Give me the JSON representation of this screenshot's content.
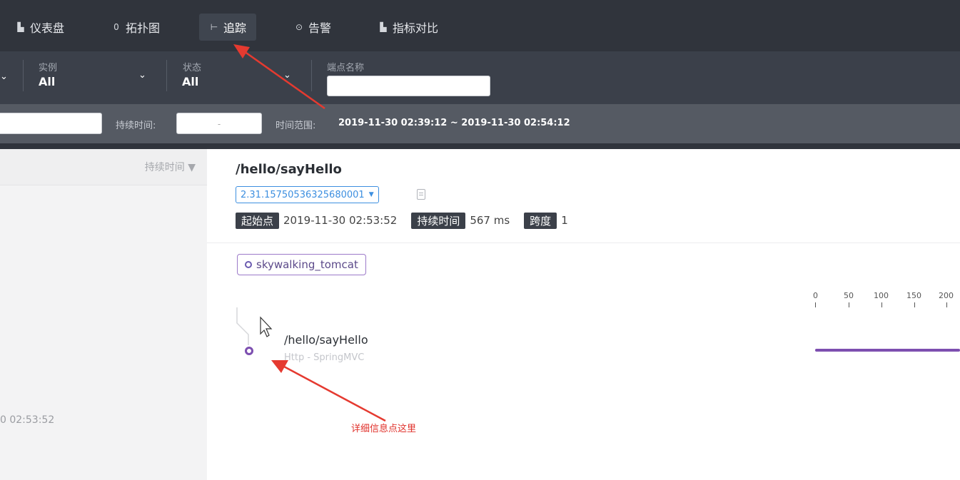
{
  "nav": {
    "items": [
      {
        "label": "仪表盘",
        "icon": "bar-chart-icon"
      },
      {
        "label": "拓扑图",
        "icon": "topology-icon"
      },
      {
        "label": "追踪",
        "icon": "trace-icon"
      },
      {
        "label": "告警",
        "icon": "alarm-icon"
      },
      {
        "label": "指标对比",
        "icon": "bar-chart-icon"
      }
    ],
    "active_label": "追踪"
  },
  "filters": {
    "instance": {
      "label": "实例",
      "value": "All"
    },
    "status": {
      "label": "状态",
      "value": "All"
    },
    "endpoint": {
      "label": "端点名称",
      "value": ""
    }
  },
  "timebar": {
    "duration_label": "持续时间:",
    "duration_dash": "-",
    "range_label": "时间范围:",
    "range_value": "2019-11-30 02:39:12 ~ 2019-11-30 02:54:12"
  },
  "list": {
    "sort_label": "持续时间 ▼",
    "item_time": "0 02:53:52"
  },
  "trace": {
    "title": "/hello/sayHello",
    "trace_id": "2.31.15750536325680001",
    "start_tag": "起始点",
    "start_value": "2019-11-30 02:53:52",
    "duration_tag": "持续时间",
    "duration_value": "567 ms",
    "span_tag": "跨度",
    "span_value": "1",
    "service": "skywalking_tomcat",
    "span_name": "/hello/sayHello",
    "span_type": "Http - SpringMVC",
    "axis_ticks": [
      "0",
      "50",
      "100",
      "150",
      "200"
    ]
  },
  "annotation": {
    "text": "详细信息点这里",
    "color": "#e0312b"
  }
}
